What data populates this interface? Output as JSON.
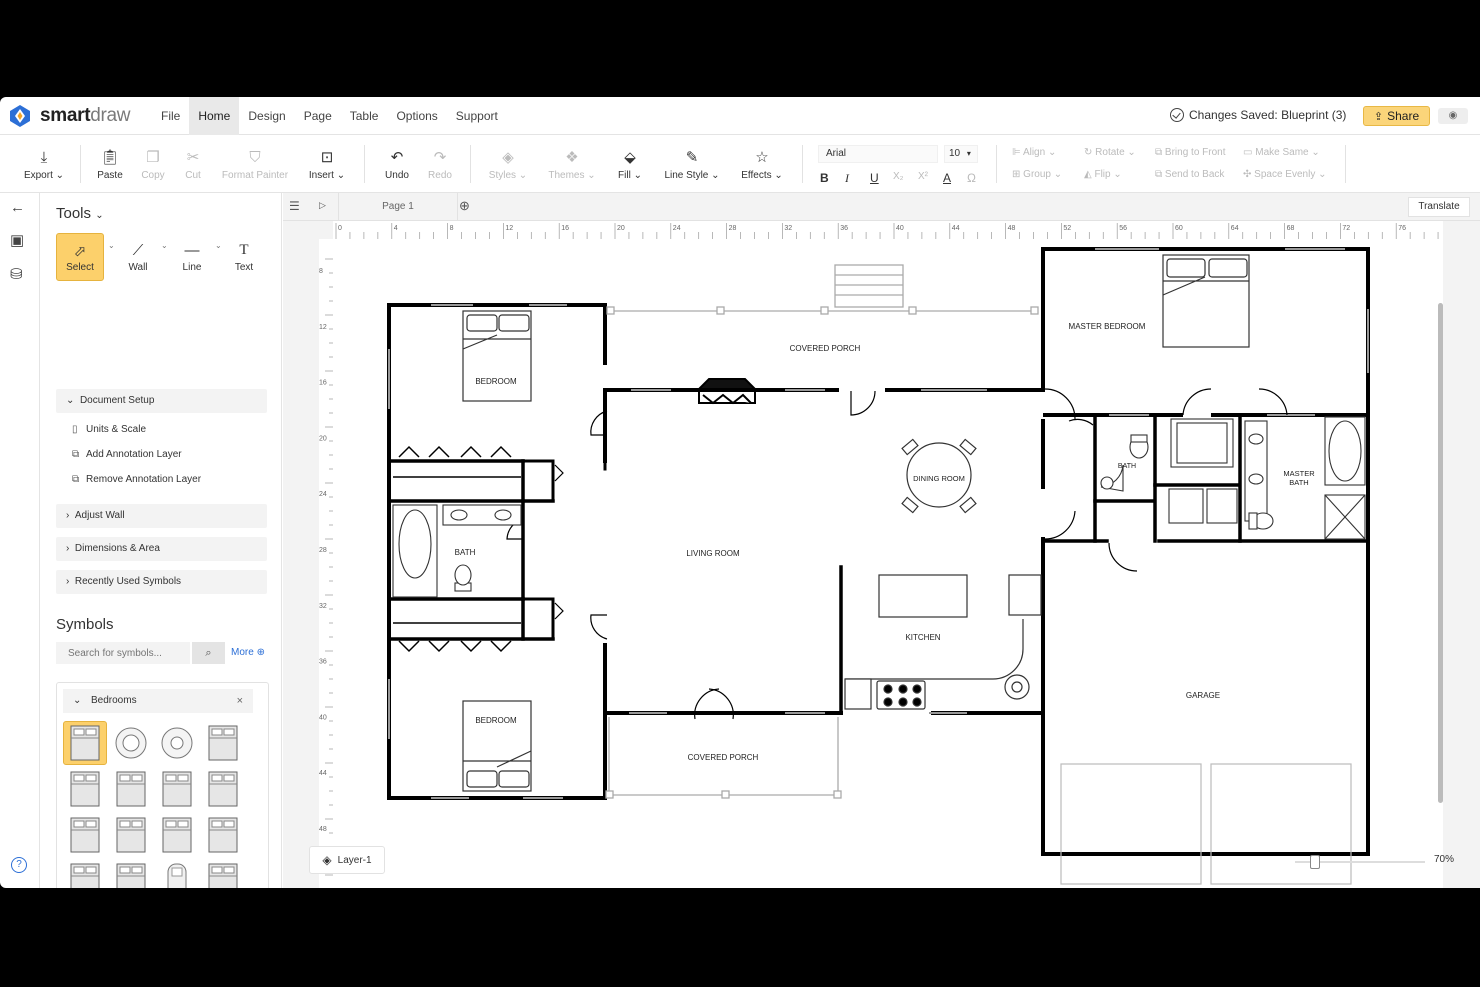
{
  "app": {
    "logo_bold": "smart",
    "logo_light": "draw"
  },
  "menu": [
    "File",
    "Home",
    "Design",
    "Page",
    "Table",
    "Options",
    "Support"
  ],
  "status": {
    "saved": "Changes Saved: Blueprint (3)"
  },
  "share_label": "Share",
  "ribbon": {
    "export": "Export",
    "paste": "Paste",
    "copy": "Copy",
    "cut": "Cut",
    "format_painter": "Format Painter",
    "insert": "Insert",
    "undo": "Undo",
    "redo": "Redo",
    "styles": "Styles",
    "themes": "Themes",
    "fill": "Fill",
    "line_style": "Line Style",
    "effects": "Effects",
    "font": "Arial",
    "font_size": "10",
    "align": "Align",
    "rotate": "Rotate",
    "bring_front": "Bring to Front",
    "make_same": "Make Same",
    "group": "Group",
    "flip": "Flip",
    "send_back": "Send to Back",
    "space_evenly": "Space Evenly",
    "bold": "B",
    "italic": "I",
    "underline": "U",
    "sub": "X₂",
    "sup": "X²",
    "text_color": "A",
    "omega": "Ω"
  },
  "tools": {
    "title": "Tools",
    "items": [
      "Select",
      "Wall",
      "Line",
      "Text"
    ],
    "document_setup": "Document Setup",
    "setup_items": [
      "Units & Scale",
      "Add Annotation Layer",
      "Remove Annotation Layer"
    ],
    "sections": [
      "Adjust Wall",
      "Dimensions & Area",
      "Recently Used Symbols"
    ]
  },
  "symbols": {
    "title": "Symbols",
    "search_placeholder": "Search for symbols...",
    "more": "More",
    "library": "Bedrooms",
    "close": "×"
  },
  "canvas": {
    "page_tab": "Page 1",
    "translate": "Translate",
    "layer": "Layer-1",
    "zoom": "70%",
    "ruler_top": [
      "0",
      "4",
      "8",
      "12",
      "16",
      "20",
      "24",
      "28",
      "32",
      "36",
      "40",
      "44",
      "48",
      "52",
      "56",
      "60",
      "64",
      "68",
      "72",
      "76"
    ],
    "ruler_left": [
      "8",
      "12",
      "16",
      "20",
      "24",
      "28",
      "32",
      "36",
      "40",
      "44",
      "48"
    ],
    "rooms": {
      "bedroom1": "BEDROOM",
      "bedroom2": "BEDROOM",
      "bath": "BATH",
      "living": "LIVING ROOM",
      "dining": "DINING ROOM",
      "kitchen": "KITCHEN",
      "porch_top": "COVERED PORCH",
      "porch_bottom": "COVERED PORCH",
      "master_bedroom": "MASTER BEDROOM",
      "bath2": "BATH",
      "master_bath_1": "MASTER",
      "master_bath_2": "BATH",
      "garage": "GARAGE"
    }
  }
}
